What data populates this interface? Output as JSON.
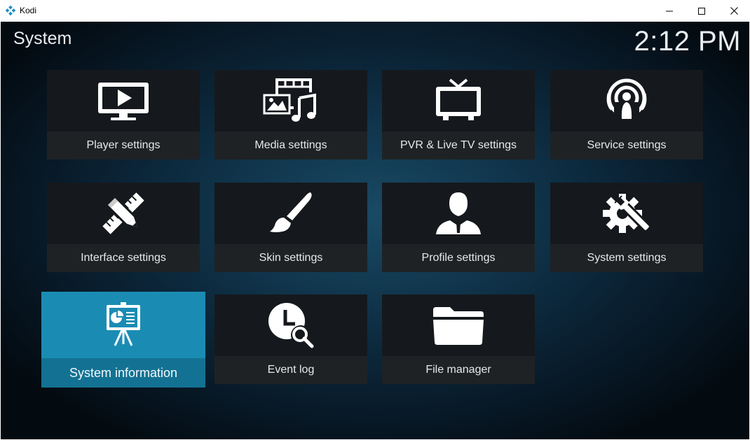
{
  "window": {
    "title": "Kodi",
    "controls": {
      "minimize_icon": "minimize-icon",
      "maximize_icon": "maximize-icon",
      "close_icon": "close-icon"
    }
  },
  "header": {
    "title": "System",
    "clock": "2:12 PM"
  },
  "tiles": [
    {
      "label": "Player settings",
      "icon": "monitor-play-icon"
    },
    {
      "label": "Media settings",
      "icon": "media-icon"
    },
    {
      "label": "PVR & Live TV settings",
      "icon": "tv-icon"
    },
    {
      "label": "Service settings",
      "icon": "podcast-icon"
    },
    {
      "label": "Interface settings",
      "icon": "pencil-ruler-icon"
    },
    {
      "label": "Skin settings",
      "icon": "paintbrush-icon"
    },
    {
      "label": "Profile settings",
      "icon": "user-icon"
    },
    {
      "label": "System settings",
      "icon": "gear-wrench-icon"
    },
    {
      "label": "System information",
      "icon": "presentation-icon",
      "focused": true
    },
    {
      "label": "Event log",
      "icon": "clock-search-icon"
    },
    {
      "label": "File manager",
      "icon": "folder-icon"
    }
  ],
  "colors": {
    "focus": "#1a8cb4",
    "focus_bar": "#137293",
    "tile": "#15191d",
    "logo": "#1f8fc4"
  }
}
